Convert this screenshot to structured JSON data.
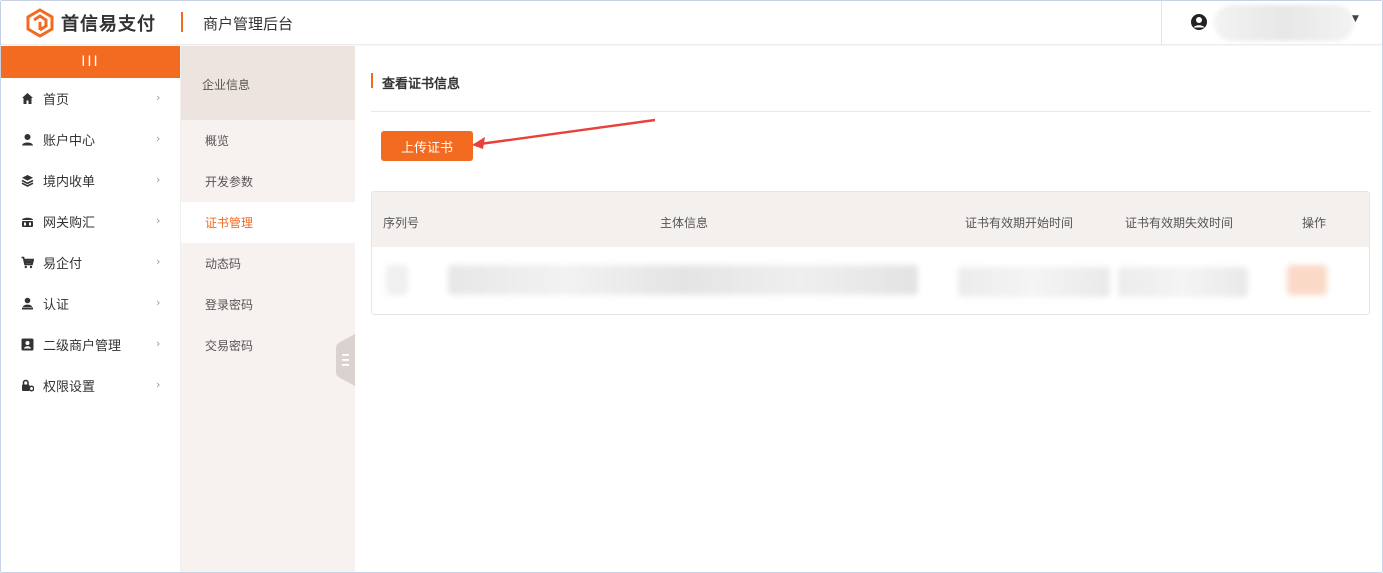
{
  "header": {
    "brand": "首信易支付",
    "subtitle": "商户管理后台",
    "user_icon": "user-circle-icon",
    "caret_icon": "caret-down-icon"
  },
  "sidebar": {
    "toggle_label": "III",
    "items": [
      {
        "label": "首页",
        "icon": "home-icon"
      },
      {
        "label": "账户中心",
        "icon": "user-icon"
      },
      {
        "label": "境内收单",
        "icon": "layers-icon"
      },
      {
        "label": "网关购汇",
        "icon": "bank-icon"
      },
      {
        "label": "易企付",
        "icon": "cart-icon"
      },
      {
        "label": "认证",
        "icon": "person-badge-icon"
      },
      {
        "label": "二级商户管理",
        "icon": "id-card-icon"
      },
      {
        "label": "权限设置",
        "icon": "lock-gear-icon"
      }
    ]
  },
  "submenu": {
    "heading": "企业信息",
    "items": [
      {
        "label": "概览",
        "active": false
      },
      {
        "label": "开发参数",
        "active": false
      },
      {
        "label": "证书管理",
        "active": true
      },
      {
        "label": "动态码",
        "active": false
      },
      {
        "label": "登录密码",
        "active": false
      },
      {
        "label": "交易密码",
        "active": false
      }
    ]
  },
  "main": {
    "title": "查看证书信息",
    "upload_button": "上传证书",
    "table": {
      "columns": [
        "序列号",
        "主体信息",
        "证书有效期开始时间",
        "证书有效期失效时间",
        "操作"
      ]
    }
  },
  "colors": {
    "accent": "#f26b21",
    "submenu_bg": "#f7f2ef",
    "table_head_bg": "#f4f0ee",
    "arrow": "#e8403a"
  }
}
